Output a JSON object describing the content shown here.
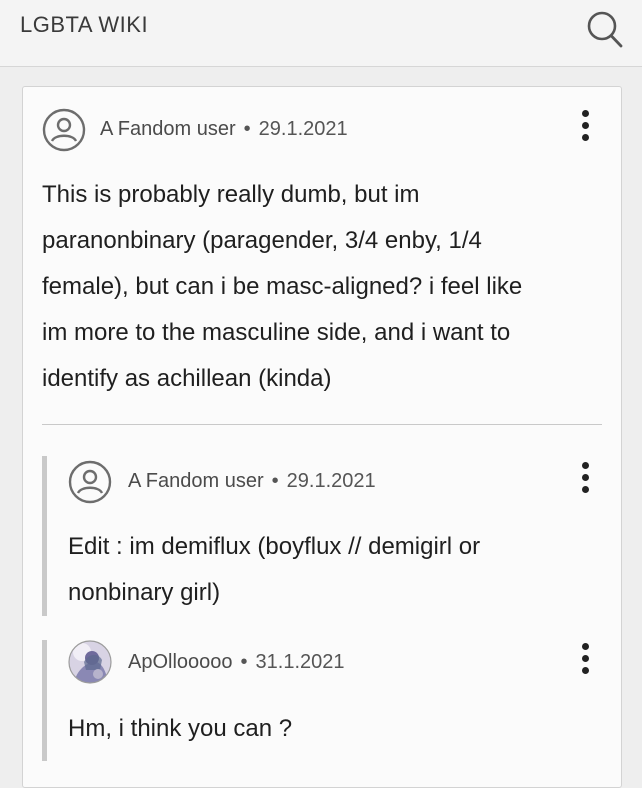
{
  "header": {
    "site_title": "LGBTA WIKI",
    "search_icon": "search-icon"
  },
  "post": {
    "author": "A Fandom user",
    "separator": "•",
    "date": "29.1.2021",
    "text_lines": [
      "This is probably really dumb, but im",
      "paranonbinary (paragender, 3/4 enby, 1/4",
      "female), but can i be masc-aligned? i feel like",
      "im more to the masculine side, and i want to",
      "identify as achillean (kinda)"
    ]
  },
  "replies": [
    {
      "author": "A Fandom user",
      "separator": "•",
      "date": "29.1.2021",
      "avatar": "user-icon",
      "text_lines": [
        "Edit : im demiflux (boyflux // demigirl or",
        "nonbinary girl)"
      ]
    },
    {
      "author": "ApOllooooo",
      "separator": "•",
      "date": "31.1.2021",
      "avatar": "photo-avatar",
      "text_lines": [
        "Hm, i think you can ?"
      ]
    }
  ],
  "colors": {
    "background": "#eeeeee",
    "card": "#fbfbfb",
    "text": "#1f1f1f",
    "meta": "#555555"
  }
}
